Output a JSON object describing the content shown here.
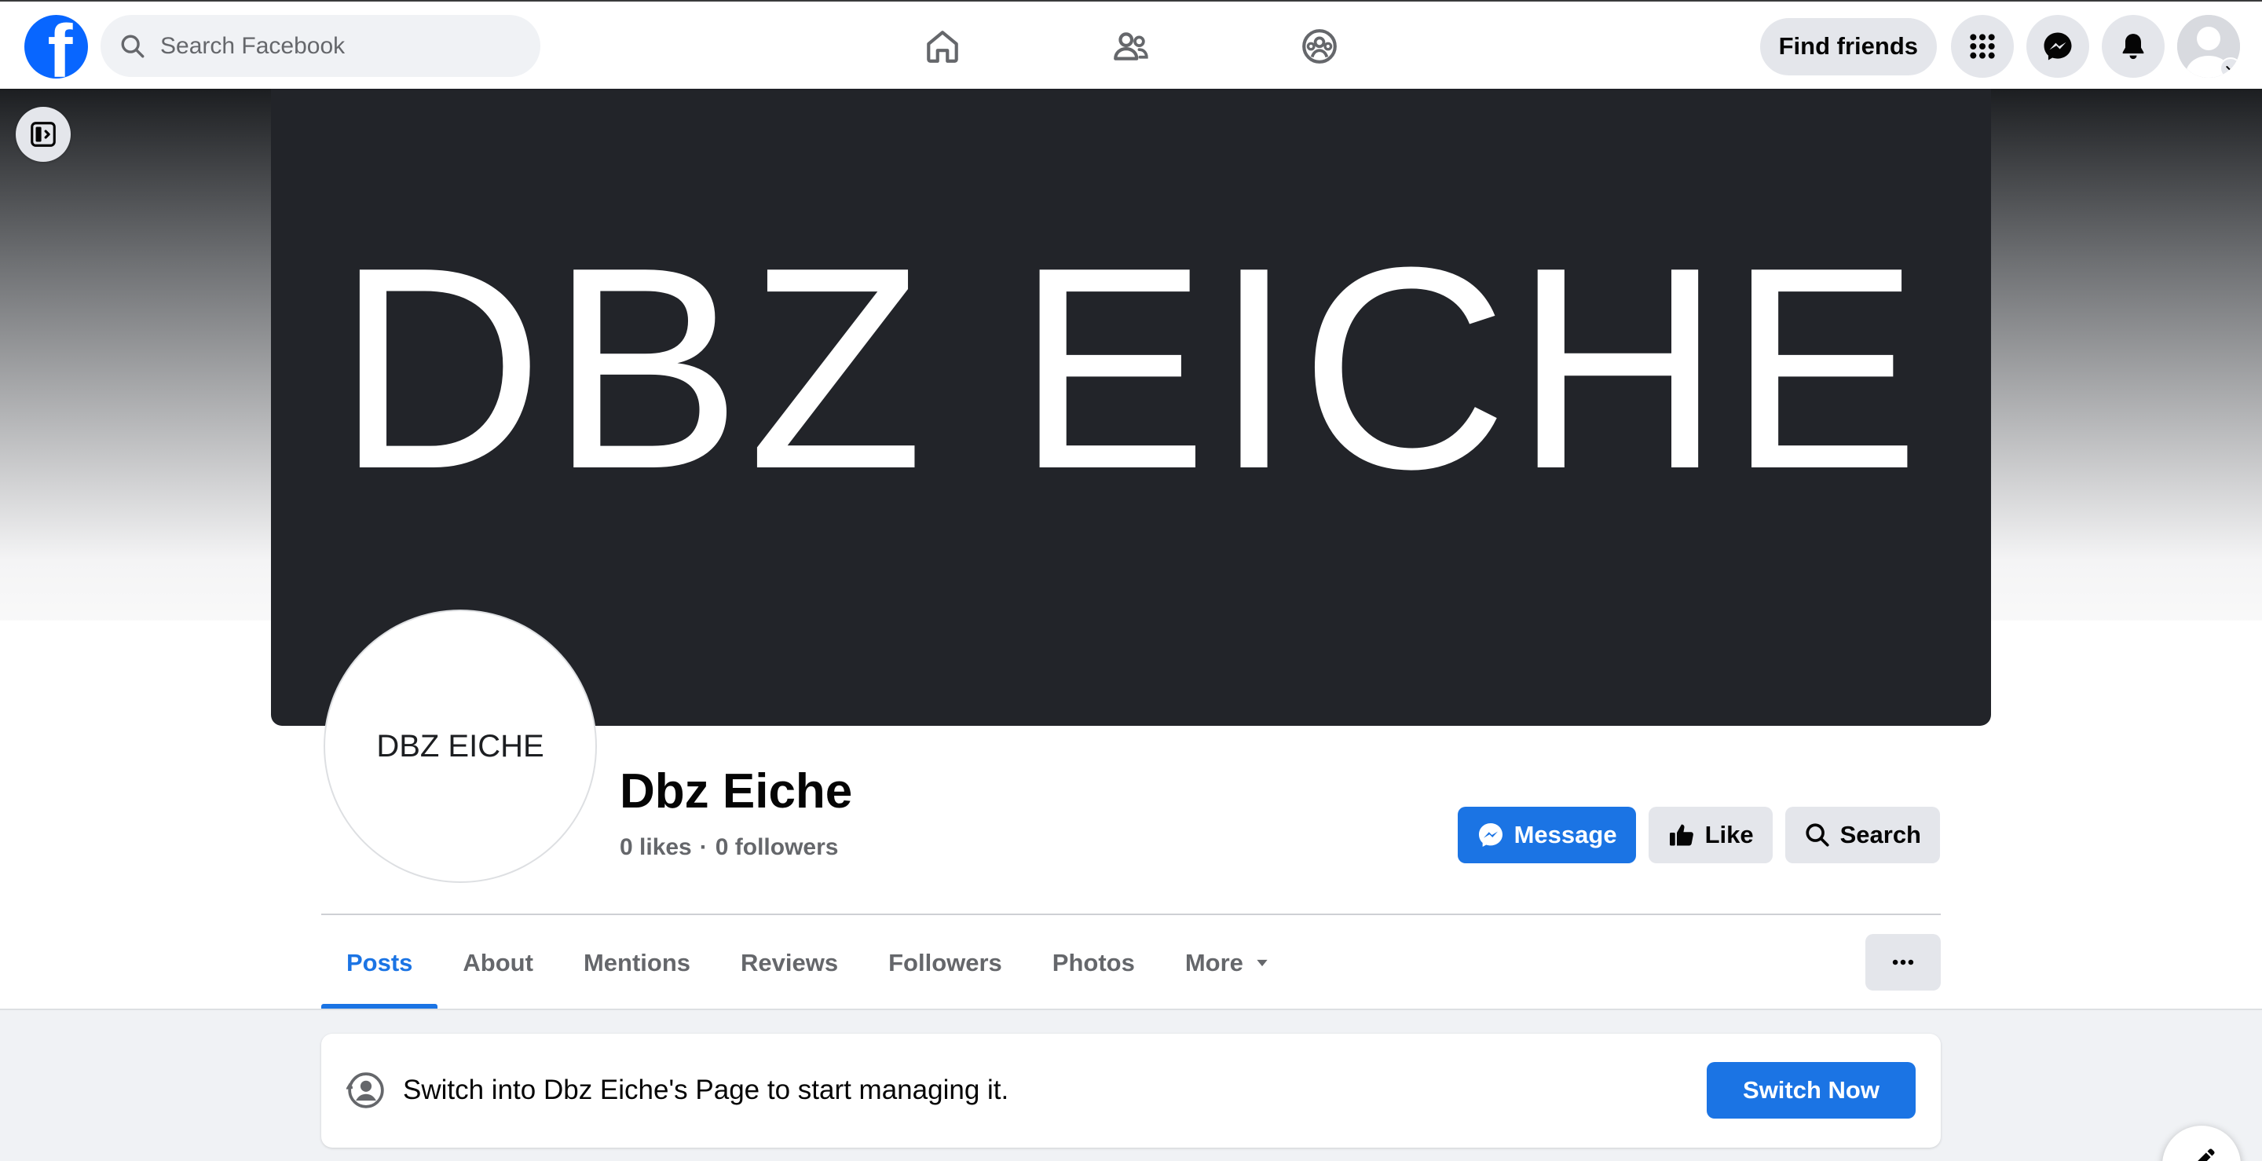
{
  "topbar": {
    "search_placeholder": "Search Facebook",
    "find_friends_label": "Find friends",
    "nav_icons": [
      "home-icon",
      "friends-icon",
      "groups-icon"
    ],
    "right_icons": [
      "menu-grid-icon",
      "messenger-icon",
      "notifications-icon",
      "account-avatar"
    ]
  },
  "page": {
    "cover_text": "DBZ EICHE",
    "profile_pic_text": "DBZ EICHE",
    "name": "Dbz Eiche",
    "likes": "0 likes",
    "separator": "·",
    "followers": "0 followers"
  },
  "actions": {
    "message_label": "Message",
    "like_label": "Like",
    "search_label": "Search"
  },
  "tabs": [
    {
      "label": "Posts",
      "active": true
    },
    {
      "label": "About",
      "active": false
    },
    {
      "label": "Mentions",
      "active": false
    },
    {
      "label": "Reviews",
      "active": false
    },
    {
      "label": "Followers",
      "active": false
    },
    {
      "label": "Photos",
      "active": false
    },
    {
      "label": "More",
      "active": false
    }
  ],
  "banner": {
    "text": "Switch into Dbz Eiche's Page to start managing it.",
    "button_label": "Switch Now"
  },
  "colors": {
    "brand_blue": "#0866ff",
    "accent_blue": "#1b74e4",
    "cover_bg": "#222429",
    "secondary_button": "#e4e6eb"
  }
}
